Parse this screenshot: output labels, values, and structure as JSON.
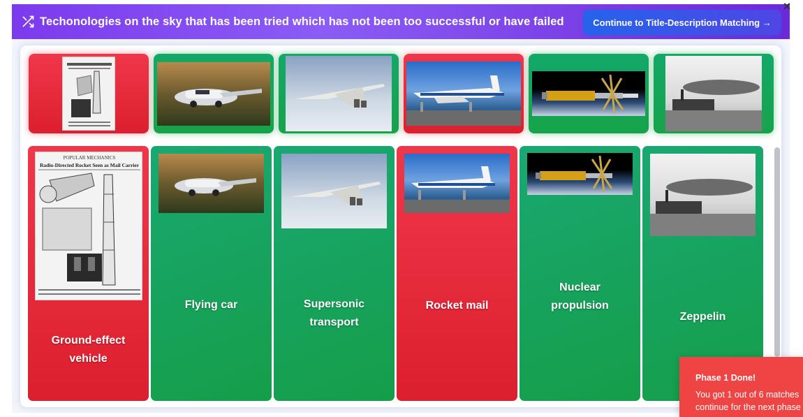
{
  "header": {
    "title": "Techonologies on the sky that has been tried which has not been too successful or have failed",
    "continue_label": "Continue to Title-Description Matching →",
    "close_label": "×"
  },
  "colors": {
    "header_start": "#7c3aed",
    "button": "#2563eb",
    "correct": "#16a34a",
    "wrong": "#dc1f2e",
    "toast": "#ef4444"
  },
  "thumbs": [
    {
      "subject": "rocket mail magazine page",
      "status": "wrong"
    },
    {
      "subject": "flying car",
      "status": "correct"
    },
    {
      "subject": "supersonic jet",
      "status": "correct"
    },
    {
      "subject": "ground-effect vehicle",
      "status": "wrong"
    },
    {
      "subject": "nuclear propulsion spacecraft",
      "status": "correct"
    },
    {
      "subject": "zeppelin",
      "status": "correct"
    }
  ],
  "columns": [
    {
      "label": "Ground-effect vehicle",
      "status": "wrong"
    },
    {
      "label": "Flying car",
      "status": "correct"
    },
    {
      "label": "Supersonic transport",
      "status": "correct"
    },
    {
      "label": "Rocket mail",
      "status": "wrong"
    },
    {
      "label": "Nuclear propulsion",
      "status": "correct"
    },
    {
      "label": "Zeppelin",
      "status": "correct"
    }
  ],
  "toast": {
    "title": "Phase 1 Done!",
    "line1": "You got 1 out of 6 matches",
    "line2": "continue for the next phase"
  },
  "magazine": {
    "masthead": "POPULAR MECHANICS",
    "headline": "Radio-Directed Rocket Seen as Mail Carrier"
  }
}
